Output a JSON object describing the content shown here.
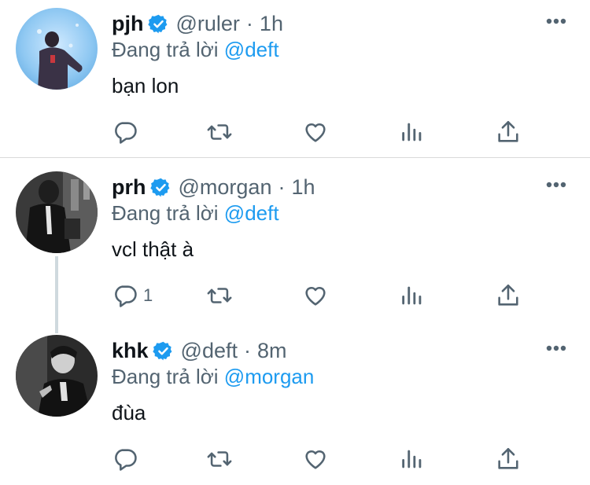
{
  "tweets": [
    {
      "name": "pjh",
      "handle": "@ruler",
      "dot": "·",
      "time": "1h",
      "reply_prefix": "Đang trả lời",
      "reply_to": "@deft",
      "text": "bạn lon",
      "reply_count": ""
    },
    {
      "name": "prh",
      "handle": "@morgan",
      "dot": "·",
      "time": "1h",
      "reply_prefix": "Đang trả lời",
      "reply_to": "@deft",
      "text": "vcl thật à",
      "reply_count": "1"
    },
    {
      "name": "khk",
      "handle": "@deft",
      "dot": "·",
      "time": "8m",
      "reply_prefix": "Đang trả lời",
      "reply_to": "@morgan",
      "text": "đùa",
      "reply_count": ""
    }
  ],
  "icons": {
    "verified": "verified-badge-icon",
    "more": "more-options-icon",
    "reply": "reply-icon",
    "retweet": "retweet-icon",
    "like": "like-icon",
    "views": "views-icon",
    "share": "share-icon"
  },
  "colors": {
    "accent": "#1d9bf0",
    "secondary_text": "#536471",
    "icon": "#536471",
    "divider": "#d9d9d9",
    "thread_line": "#cfd9de"
  }
}
